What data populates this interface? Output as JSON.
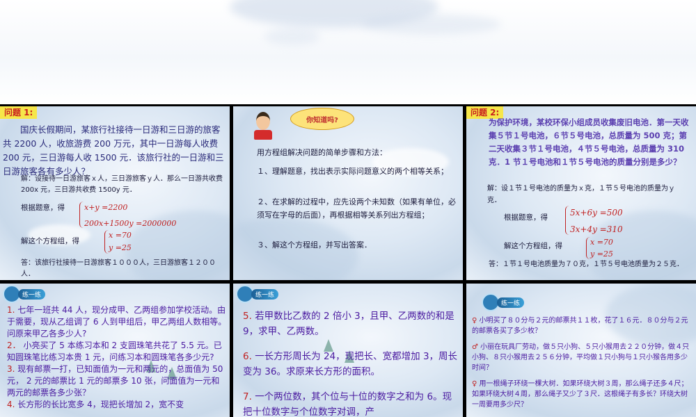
{
  "panel1": {
    "label": "问题 1:",
    "problem": "国庆长假期间，某旅行社接待一日游和三日游的旅客共 2200 人，收旅游费 200 万元，其中一日游每人收费 200 元，三日游每人收 1500 元．该旅行社的一日游和三日游旅客各有多少人？",
    "setup": "解：设接待一日游旅客ｘ人，三日游旅客ｙ人．那么一日游共收费 200x 元，三日游共收费 1500y 元．",
    "by_question": "根据题意，得",
    "eq1": "x+y =2200",
    "eq2": "200x+1500y =2000000",
    "solve_label": "解这个方程组，得",
    "sol1": "x =70",
    "sol2": "y =25",
    "answer": "答：该旅行社接待一日游旅客１０００人，三日游旅客１２００人．"
  },
  "panel2": {
    "bubble": "你知道吗?",
    "steps": [
      "用方程组解决问题的简单步骤和方法：",
      "１、理解题意，找出表示实际问题意义的两个相等关系；",
      "２、在求解的过程中，应先设两个未知数（如果有单位，必须写在字母的后面），再根据相等关系列出方程组；",
      "３、解这个方程组，并写出答案．"
    ]
  },
  "panel3": {
    "label": "问题 2:",
    "problem": "为保护环境，某校环保小组成员收集废旧电池．第一天收集５节１号电池，６节５号电池，总质量为 500 克；第二天收集３节１号电池，４节５号电池，总质量为 310 克．1 节１号电池和１节５号电池的质量分别是多少？",
    "setup": "解：设１节１号电池的质量为ｘ克，１节５号电池的质量为ｙ克．",
    "by_question": "根据题意，得",
    "eq1": "5x+6y =500",
    "eq2": "3x+4y =310",
    "solve_label": "解这个方程组，得",
    "sol1": "x =70",
    "sol2": "y =25",
    "answer": "答：１节１号电池质量为７０克，１节５号电池质量为２５克．"
  },
  "panel4": {
    "badge": "练一练",
    "items": [
      {
        "num": "1.",
        "text": "七年一班共 44 人，现分成甲、乙两组参加学校活动。由于需要，现从乙组调了 6 人到甲组后，甲乙两组人数相等。问原来甲乙各多少人?"
      },
      {
        "num": "2．",
        "text": "小亮买了 5 本练习本和 2 支圆珠笔共花了 5.5 元。已知圆珠笔比练习本贵 1 元，问练习本和圆珠笔各多少元?"
      },
      {
        "num": "3.",
        "text": "现有邮票一打，已知面值为一元和两元的，总面值为 50 元， 2 元的邮票比 1 元的邮票多 10 张，问面值为一元和两元的邮票各多少张？"
      },
      {
        "num": "4.",
        "text": "长方形的长比宽多 4，现把长增加 2，宽不变"
      }
    ]
  },
  "panel5": {
    "badge": "练一练",
    "items": [
      {
        "num": "5.",
        "text": "若甲数比乙数的 2 倍小 3，且甲、乙两数的和是 9，求甲、乙两数。"
      },
      {
        "num": "6.",
        "text": "一长方形周长为 24，现把长、宽都增加 3，周长变为 36。求原来长方形的面积。"
      },
      {
        "num": "7.",
        "text": "一个两位数，其个位与十位的数字之和为 6。现把十位数字与个位数字对调，产"
      }
    ]
  },
  "panel6": {
    "badge": "练一练",
    "items": [
      {
        "bullet": "♀",
        "text": "小明买了８０分与２元的邮票共１１枚，花了１６元．８０分与２元的邮票各买了多少枚？"
      },
      {
        "bullet": "♂",
        "text": "小丽在玩具厂劳动，做５只小狗、５只小猴用去２２０分钟，做４只小狗、８只小猴用去２５６分钟，平均做１只小狗与１只小猴各用多少时间？"
      },
      {
        "bullet": "♀",
        "text": "用一根绳子环绕一棵大树．如果环绕大树３周，那么绳子还多４尺；如果环绕大树４周，那么绳子又少了３尺．这根绳子有多长？环绕大树一周要用多少尺？"
      }
    ]
  }
}
